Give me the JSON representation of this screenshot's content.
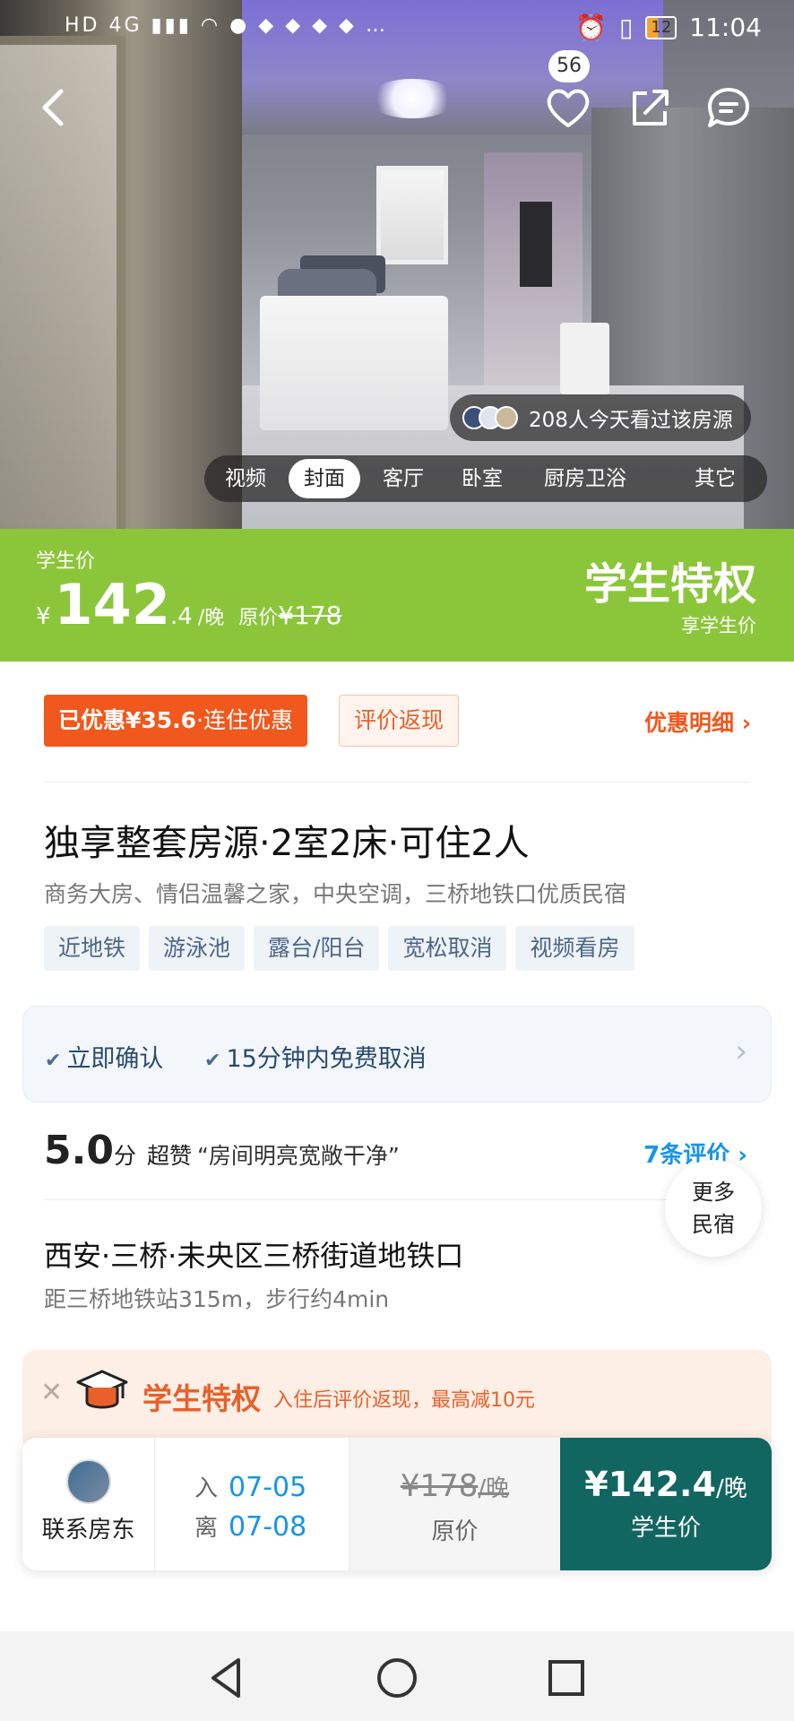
{
  "status_bar": {
    "left_indicators": "HD 4G",
    "battery": "12",
    "time": "11:04"
  },
  "header": {
    "favorite_count": "56",
    "icons": [
      "chevron-left-icon",
      "heart-icon",
      "share-icon",
      "chat-icon"
    ]
  },
  "photo": {
    "viewers_text": "208人今天看过该房源",
    "tabs": [
      {
        "label": "视频"
      },
      {
        "label": "封面"
      },
      {
        "label": "客厅"
      },
      {
        "label": "卧室"
      },
      {
        "label": "厨房卫浴"
      },
      {
        "label": "其它"
      }
    ],
    "active_tab": "封面"
  },
  "price_banner": {
    "label": "学生价",
    "currency": "¥",
    "price_int": "142",
    "price_dec": ".4",
    "unit": "/晚",
    "orig_label": "原价",
    "orig_price": "¥178",
    "title": "学生特权",
    "subtitle": "享学生价",
    "color": "#8bc63a"
  },
  "discounts": {
    "applied_prefix": "已优惠¥35.6",
    "applied_suffix": "·连住优惠",
    "cashback": "评价返现",
    "detail_link": "优惠明细"
  },
  "listing": {
    "title": "独享整套房源·2室2床·可住2人",
    "subtitle": "商务大房、情侣温馨之家，中央空调，三桥地铁口优质民宿",
    "tags": [
      "近地铁",
      "游泳池",
      "露台/阳台",
      "宽松取消",
      "视频看房"
    ]
  },
  "policies": {
    "items": [
      "立即确认",
      "15分钟内免费取消"
    ]
  },
  "rating": {
    "score": "5.0",
    "unit": "分",
    "level": "超赞",
    "quote": "“房间明亮宽敞干净”",
    "reviews_link": "7条评价"
  },
  "more_bnb": {
    "line1": "更多",
    "line2": "民宿"
  },
  "location": {
    "address": "西安·三桥·未央区三桥街道地铁口",
    "distance": "距三桥地铁站315m，步行约4min"
  },
  "promo": {
    "title": "学生特权",
    "desc": "入住后评价返现，最高减10元"
  },
  "booking": {
    "contact_label": "联系房东",
    "checkin_label": "入",
    "checkin_date": "07-05",
    "checkout_label": "离",
    "checkout_date": "07-08",
    "orig_price": "¥178",
    "orig_unit": "/晚",
    "orig_label": "原价",
    "student_price": "¥142.4",
    "student_unit": "/晚",
    "student_label": "学生价",
    "accent": "#126662"
  },
  "navbar": {
    "icons": [
      "back-triangle-icon",
      "home-circle-icon",
      "recents-square-icon"
    ]
  }
}
